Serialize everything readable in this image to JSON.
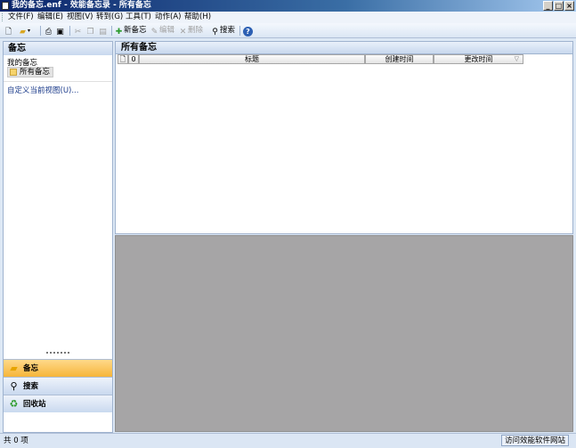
{
  "window": {
    "title": "我的备忘.enf - 效能备忘录 - 所有备忘"
  },
  "menu": [
    "文件(F)",
    "编辑(E)",
    "视图(V)",
    "转到(G)",
    "工具(T)",
    "动作(A)",
    "帮助(H)"
  ],
  "toolbar": {
    "new_note": "新备忘",
    "edit": "编辑",
    "delete": "删除",
    "search": "搜索"
  },
  "left_panel": {
    "header": "备忘",
    "section": "我的备忘",
    "selected_item": "所有备忘",
    "customize": "自定义当前视图(U)...",
    "nav": {
      "notes": "备忘",
      "search": "搜索",
      "recycle_bin": "回收站"
    }
  },
  "main": {
    "header": "所有备忘",
    "columns": {
      "attach": "0",
      "title": "标题",
      "created": "创建时间",
      "modified": "更改时间"
    }
  },
  "status": {
    "count": "共 0 项",
    "link": "访问效能软件网站"
  }
}
